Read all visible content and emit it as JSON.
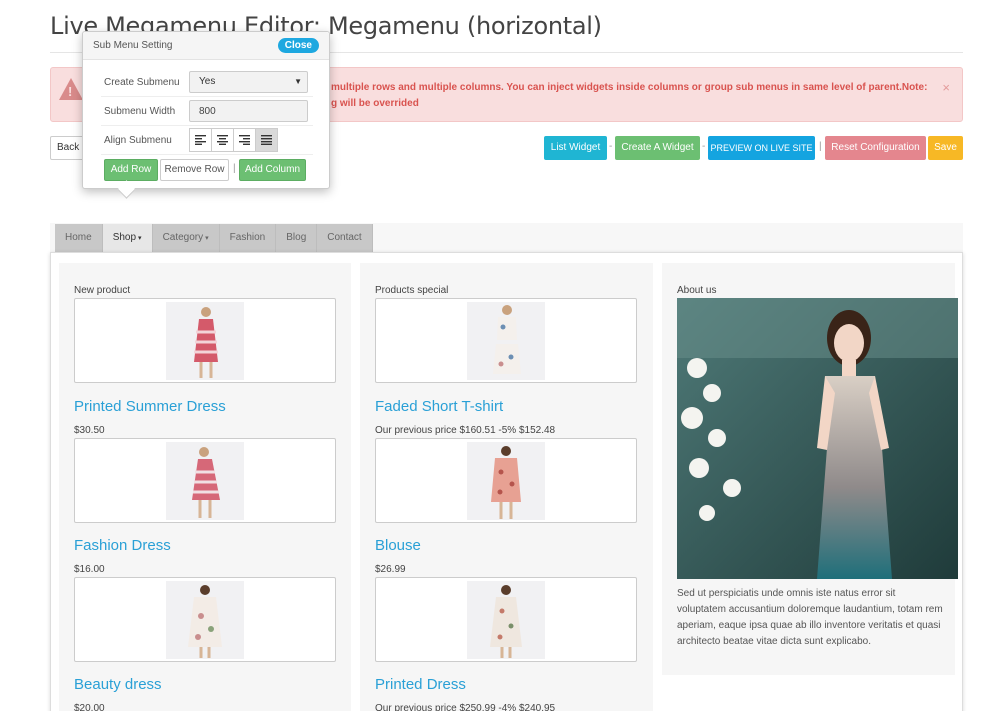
{
  "page": {
    "title": "Live Megamenu Editor: Megamenu (horizontal)"
  },
  "alert": {
    "text": "multiple rows and multiple columns. You can inject widgets inside columns or group sub menus in same level of parent.Note:\ng will be overrided",
    "close_symbol": "×"
  },
  "toolbar": {
    "back_label": "Back",
    "list_widget_label": "List Widget",
    "create_widget_label": "Create A Widget",
    "preview_label": "PREVIEW ON LIVE SITE",
    "reset_label": "Reset Configuration",
    "save_label": "Save",
    "separator": "-",
    "pipe": "|"
  },
  "colors": {
    "cyan": "#1fb5d3",
    "green": "#6cbf72",
    "blue": "#14a4e0",
    "pink": "#e4868e",
    "orange": "#f7b825",
    "link": "#2aa0d6"
  },
  "popup": {
    "title": "Sub Menu Setting",
    "close_label": "Close",
    "create_submenu_label": "Create Submenu",
    "create_submenu_value": "Yes",
    "submenu_width_label": "Submenu Width",
    "submenu_width_value": "800",
    "align_label": "Align Submenu",
    "align_icons": [
      "align-left-icon",
      "align-center-icon",
      "align-right-icon",
      "align-justify-icon"
    ],
    "add_row_label": "Add Row",
    "remove_row_label": "Remove Row",
    "pipe": "|",
    "add_column_label": "Add Column"
  },
  "menu": {
    "items": [
      {
        "label": "Home"
      },
      {
        "label": "Shop"
      },
      {
        "label": "Category"
      },
      {
        "label": "Fashion"
      },
      {
        "label": "Blog"
      },
      {
        "label": "Contact"
      }
    ],
    "caret": "▾"
  },
  "columns": [
    {
      "title": "New product",
      "products": [
        {
          "name": "Printed Summer Dress",
          "price": "$30.50"
        },
        {
          "name": "Fashion Dress",
          "price": "$16.00"
        },
        {
          "name": "Beauty dress",
          "price": "$20.00"
        }
      ]
    },
    {
      "title": "Products special",
      "products": [
        {
          "name": "Faded Short T-shirt",
          "price": "Our previous price $160.51 -5% $152.48"
        },
        {
          "name": "Blouse",
          "price": "$26.99"
        },
        {
          "name": "Printed Dress",
          "price": "Our previous price $250.99 -4% $240.95"
        }
      ]
    }
  ],
  "about": {
    "title": "About us",
    "text": "Sed ut perspiciatis unde omnis iste natus error sit voluptatem accusantium doloremque laudantium, totam rem aperiam, eaque ipsa quae ab illo inventore veritatis et quasi architecto beatae vitae dicta sunt explicabo."
  }
}
